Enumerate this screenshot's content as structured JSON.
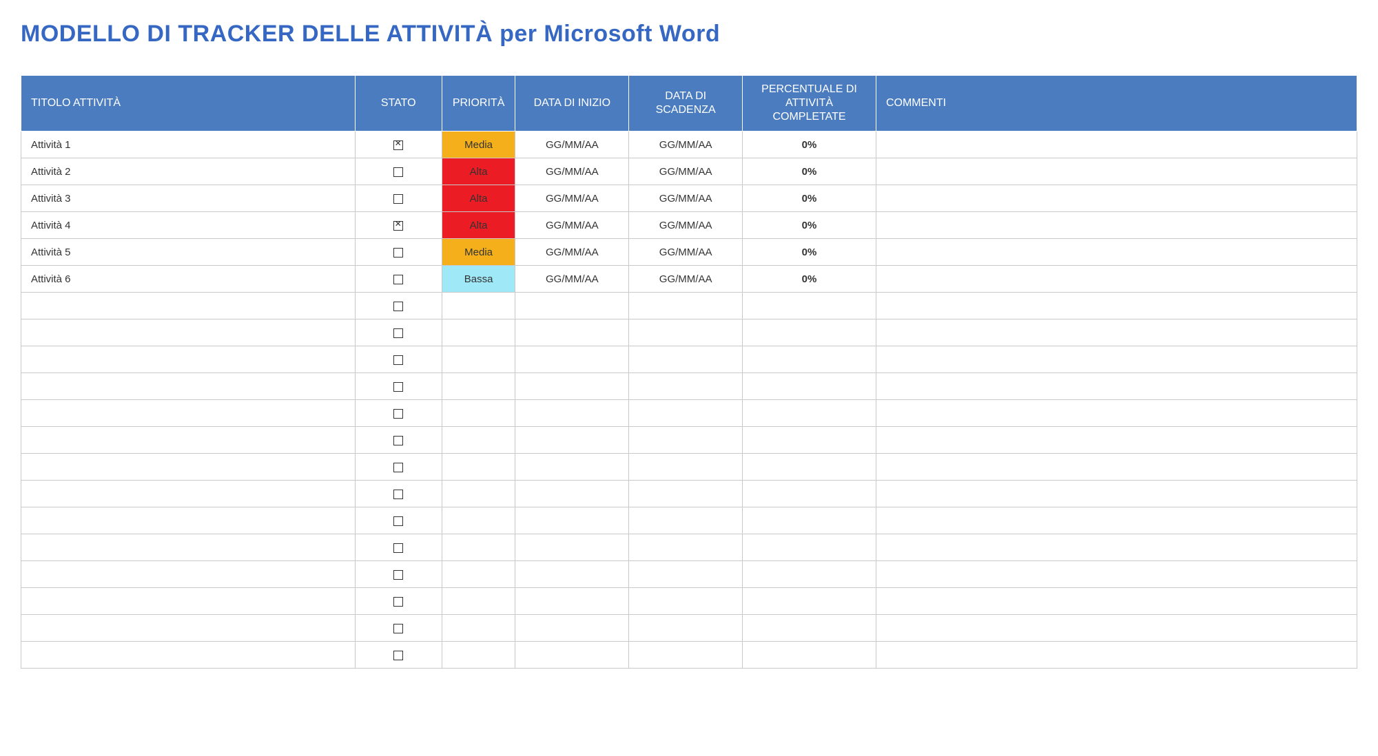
{
  "title": "MODELLO DI TRACKER DELLE ATTIVITÀ per Microsoft Word",
  "headers": {
    "title": "TITOLO ATTIVITÀ",
    "status": "STATO",
    "priority": "PRIORITÀ",
    "start": "DATA DI INIZIO",
    "due": "DATA DI SCADENZA",
    "percent": "PERCENTUALE DI ATTIVITÀ COMPLETATE",
    "comments": "COMMENTI"
  },
  "priority_colors": {
    "Media": "#f4af1b",
    "Alta": "#ec1c24",
    "Bassa": "#9fe8f7"
  },
  "rows": [
    {
      "title": "Attività 1",
      "status_checked": true,
      "priority": "Media",
      "start": "GG/MM/AA",
      "due": "GG/MM/AA",
      "percent": "0%",
      "comments": ""
    },
    {
      "title": "Attività 2",
      "status_checked": false,
      "priority": "Alta",
      "start": "GG/MM/AA",
      "due": "GG/MM/AA",
      "percent": "0%",
      "comments": ""
    },
    {
      "title": "Attività 3",
      "status_checked": false,
      "priority": "Alta",
      "start": "GG/MM/AA",
      "due": "GG/MM/AA",
      "percent": "0%",
      "comments": ""
    },
    {
      "title": "Attività 4",
      "status_checked": true,
      "priority": "Alta",
      "start": "GG/MM/AA",
      "due": "GG/MM/AA",
      "percent": "0%",
      "comments": ""
    },
    {
      "title": "Attività 5",
      "status_checked": false,
      "priority": "Media",
      "start": "GG/MM/AA",
      "due": "GG/MM/AA",
      "percent": "0%",
      "comments": ""
    },
    {
      "title": "Attività 6",
      "status_checked": false,
      "priority": "Bassa",
      "start": "GG/MM/AA",
      "due": "GG/MM/AA",
      "percent": "0%",
      "comments": ""
    },
    {
      "title": "",
      "status_checked": false,
      "priority": "",
      "start": "",
      "due": "",
      "percent": "",
      "comments": ""
    },
    {
      "title": "",
      "status_checked": false,
      "priority": "",
      "start": "",
      "due": "",
      "percent": "",
      "comments": ""
    },
    {
      "title": "",
      "status_checked": false,
      "priority": "",
      "start": "",
      "due": "",
      "percent": "",
      "comments": ""
    },
    {
      "title": "",
      "status_checked": false,
      "priority": "",
      "start": "",
      "due": "",
      "percent": "",
      "comments": ""
    },
    {
      "title": "",
      "status_checked": false,
      "priority": "",
      "start": "",
      "due": "",
      "percent": "",
      "comments": ""
    },
    {
      "title": "",
      "status_checked": false,
      "priority": "",
      "start": "",
      "due": "",
      "percent": "",
      "comments": ""
    },
    {
      "title": "",
      "status_checked": false,
      "priority": "",
      "start": "",
      "due": "",
      "percent": "",
      "comments": ""
    },
    {
      "title": "",
      "status_checked": false,
      "priority": "",
      "start": "",
      "due": "",
      "percent": "",
      "comments": ""
    },
    {
      "title": "",
      "status_checked": false,
      "priority": "",
      "start": "",
      "due": "",
      "percent": "",
      "comments": ""
    },
    {
      "title": "",
      "status_checked": false,
      "priority": "",
      "start": "",
      "due": "",
      "percent": "",
      "comments": ""
    },
    {
      "title": "",
      "status_checked": false,
      "priority": "",
      "start": "",
      "due": "",
      "percent": "",
      "comments": ""
    },
    {
      "title": "",
      "status_checked": false,
      "priority": "",
      "start": "",
      "due": "",
      "percent": "",
      "comments": ""
    },
    {
      "title": "",
      "status_checked": false,
      "priority": "",
      "start": "",
      "due": "",
      "percent": "",
      "comments": ""
    },
    {
      "title": "",
      "status_checked": false,
      "priority": "",
      "start": "",
      "due": "",
      "percent": "",
      "comments": ""
    }
  ]
}
